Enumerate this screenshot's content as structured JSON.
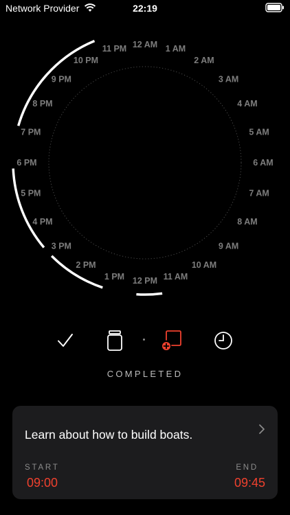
{
  "status_bar": {
    "carrier": "Network Provider",
    "time": "22:19",
    "wifi_icon": "wifi-icon",
    "battery_icon": "battery-full-icon"
  },
  "clock": {
    "hour_labels": [
      "12 AM",
      "1 AM",
      "2 AM",
      "3 AM",
      "4 AM",
      "5 AM",
      "6 AM",
      "7 AM",
      "8 AM",
      "9 AM",
      "10 AM",
      "11 AM",
      "12 PM",
      "1 PM",
      "2 PM",
      "3 PM",
      "4 PM",
      "5 PM",
      "6 PM",
      "7 PM",
      "8 PM",
      "9 PM",
      "10 PM",
      "11 PM"
    ],
    "scheduled_arcs": [
      {
        "start": "13:15",
        "end": "15:00"
      },
      {
        "start": "15:20",
        "end": "17:50"
      },
      {
        "start": "19:05",
        "end": "22:30"
      },
      {
        "start": "11:30",
        "end": "12:15"
      }
    ],
    "accent_color": "#ffffff",
    "label_color": "#7d7d7d"
  },
  "toolbar": {
    "items": [
      {
        "name": "completed-check-icon",
        "active": false
      },
      {
        "name": "jar-icon",
        "active": false
      },
      {
        "name": "add-task-icon",
        "active": true
      },
      {
        "name": "clock-icon",
        "active": false
      }
    ],
    "active_color": "#f0412e"
  },
  "mode_label": "COMPLETED",
  "task": {
    "title": "Learn about how to build boats.",
    "start_label": "START",
    "start_time": "09:00",
    "end_label": "END",
    "end_time": "09:45",
    "accent_color": "#f0412e"
  }
}
